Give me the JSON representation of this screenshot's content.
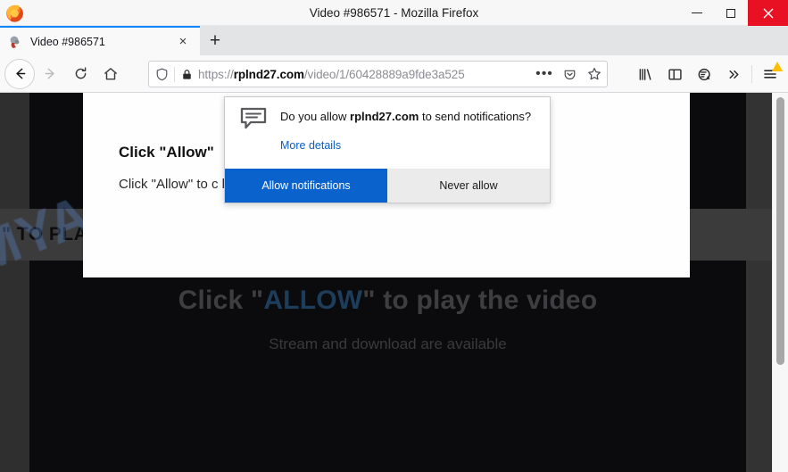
{
  "window": {
    "title": "Video #986571 - Mozilla Firefox",
    "minimize_label": "Minimize",
    "maximize_label": "Maximize",
    "close_label": "Close"
  },
  "tabs": {
    "items": [
      {
        "label": "Video #986571",
        "close_label": "×",
        "favicon": "video-page-favicon"
      }
    ],
    "new_tab_label": "+"
  },
  "nav": {
    "back_label": "←",
    "forward_label": "→",
    "reload_label": "↻",
    "home_label": "Home"
  },
  "urlbar": {
    "protocol": "https://",
    "domain": "rplnd27.com",
    "path": "/video/1/60428889a9fde3a525",
    "full_url": "https://rplnd27.com/video/1/60428889a9fde3a525",
    "page_actions_label": "•••",
    "pocket_label": "Save to Pocket",
    "bookmark_label": "Bookmark this page",
    "shield_label": "tracking-protection-shield",
    "lock_label": "connection-secure-lock"
  },
  "toolbar_right": {
    "library_label": "Library",
    "sidebar_label": "Sidebar",
    "sync_label": "Account / Sync",
    "overflow_label": "»",
    "menu_label": "Open menu"
  },
  "doorhanger": {
    "question_prefix": "Do you allow ",
    "question_domain": "rplnd27.com",
    "question_suffix": " to send notifications?",
    "more_details": "More details",
    "allow_label": "Allow notifications",
    "never_label": "Never allow",
    "icon": "notification-bubble-icon"
  },
  "page": {
    "panel_heading": "Click \"Allow\"",
    "panel_paragraph": "Click \"Allow\" to c                                        k on detailed information",
    "banner_text": "\" TO PLA",
    "headline_before": "Click \"",
    "headline_highlight": "ALLOW",
    "headline_after": "\" to play the video",
    "subtext": "Stream and download are available",
    "watermark": "MYANTISPYWARE.COM"
  },
  "colors": {
    "accent_blue": "#0a62cc",
    "tab_accent": "#0a84ff",
    "close_red": "#e81123",
    "warning_yellow": "#ffbf00",
    "link_blue": "#0a5fc4",
    "headline_highlight": "#1d3d5c",
    "watermark_blue": "#5a7fbe"
  }
}
